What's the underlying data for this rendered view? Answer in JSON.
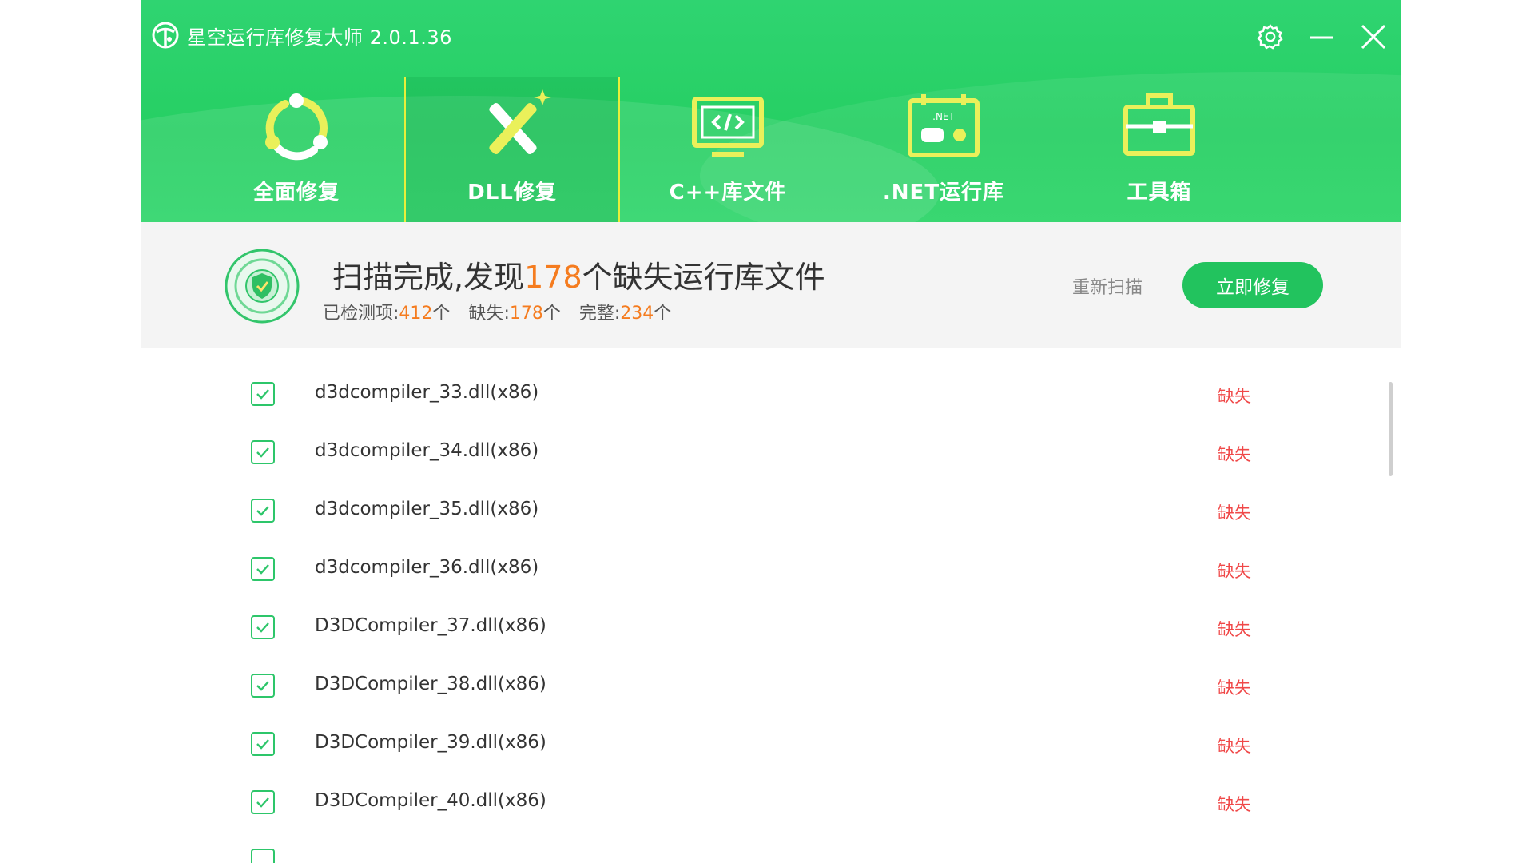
{
  "app": {
    "title": "星空运行库修复大师 2.0.1.36"
  },
  "window": {
    "settings_icon": "gear-icon",
    "minimize_icon": "minimize-icon",
    "close_icon": "close-icon"
  },
  "nav": {
    "items": [
      {
        "label": "全面修复",
        "icon": "full-repair-icon",
        "active": false
      },
      {
        "label": "DLL修复",
        "icon": "dll-repair-icon",
        "active": true
      },
      {
        "label": "C++库文件",
        "icon": "cpp-library-icon",
        "active": false
      },
      {
        "label": ".NET运行库",
        "icon": "dotnet-runtime-icon",
        "active": false
      },
      {
        "label": "工具箱",
        "icon": "toolbox-icon",
        "active": false
      }
    ]
  },
  "summary": {
    "title_prefix": "扫描完成,发现",
    "missing_count": "178",
    "title_suffix": "个缺失运行库文件",
    "detected_label": "已检测项:",
    "detected_value": "412",
    "missing_label": "缺失:",
    "missing_value": "178",
    "complete_label": "完整:",
    "complete_value": "234",
    "unit": "个",
    "rescan_label": "重新扫描",
    "fix_now_label": "立即修复"
  },
  "files": [
    {
      "name": "d3dcompiler_33.dll(x86)",
      "status": "缺失",
      "checked": true
    },
    {
      "name": "d3dcompiler_34.dll(x86)",
      "status": "缺失",
      "checked": true
    },
    {
      "name": "d3dcompiler_35.dll(x86)",
      "status": "缺失",
      "checked": true
    },
    {
      "name": "d3dcompiler_36.dll(x86)",
      "status": "缺失",
      "checked": true
    },
    {
      "name": "D3DCompiler_37.dll(x86)",
      "status": "缺失",
      "checked": true
    },
    {
      "name": "D3DCompiler_38.dll(x86)",
      "status": "缺失",
      "checked": true
    },
    {
      "name": "D3DCompiler_39.dll(x86)",
      "status": "缺失",
      "checked": true
    },
    {
      "name": "D3DCompiler_40.dll(x86)",
      "status": "缺失",
      "checked": true
    }
  ],
  "colors": {
    "brand_green": "#22c35e",
    "header_green": "#2ad467",
    "highlight_orange": "#f57c1f",
    "missing_red": "#f04848",
    "active_border": "#e8ef3a"
  }
}
